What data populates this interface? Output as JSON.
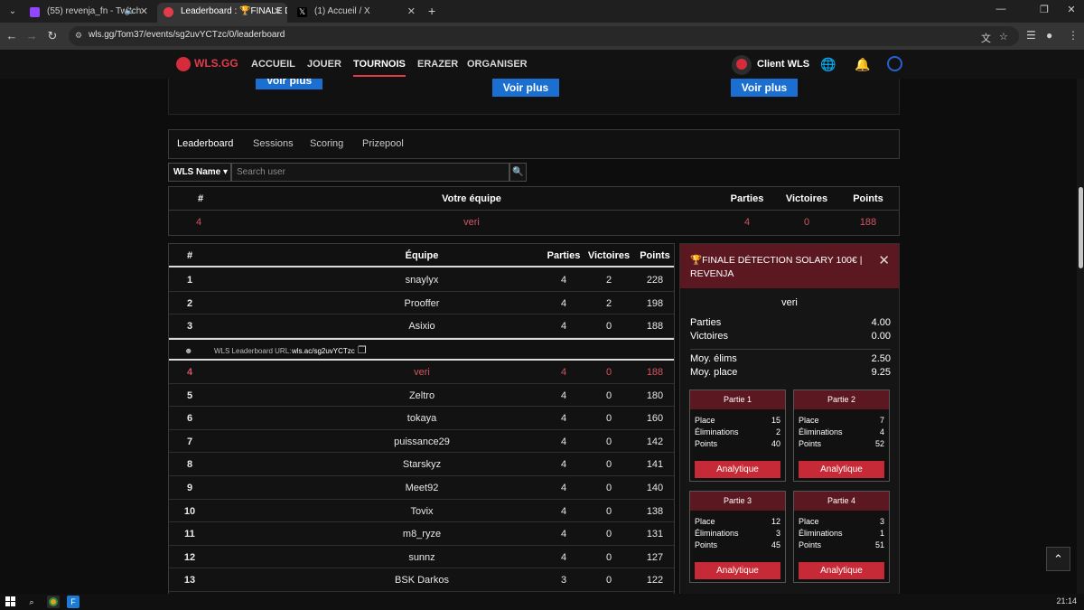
{
  "browser": {
    "tabs": [
      {
        "title": "(55) revenja_fn - Twitch",
        "favicon_color": "#9146ff"
      },
      {
        "title": "Leaderboard : 🏆FINALE DÉTECTI",
        "favicon_color": "#e23b4a"
      },
      {
        "title": "(1) Accueil / X",
        "favicon_color": "#000000"
      }
    ],
    "new_tab_label": "+",
    "url": "wls.gg/Tom37/events/sg2uvYCTzc/0/leaderboard"
  },
  "site": {
    "logo": "WLS.GG",
    "nav": [
      "ACCUEIL",
      "JOUER",
      "TOURNOIS",
      "ERAZER",
      "ORGANISER"
    ],
    "active_nav": "TOURNOIS",
    "client_label": "Client WLS"
  },
  "top_panel": {
    "buttons": [
      "Voir plus",
      "Voir plus",
      "Voir plus"
    ]
  },
  "subtabs": [
    "Leaderboard",
    "Sessions",
    "Scoring",
    "Prizepool"
  ],
  "search": {
    "filter_label": "WLS Name",
    "placeholder": "Search user"
  },
  "your_team": {
    "headers": {
      "rank": "#",
      "team": "Votre équipe",
      "games": "Parties",
      "wins": "Victoires",
      "points": "Points"
    },
    "row": {
      "rank": "4",
      "team": "veri",
      "games": "4",
      "wins": "0",
      "points": "188"
    }
  },
  "leaderboard": {
    "headers": {
      "rank": "#",
      "team": "Équipe",
      "games": "Parties",
      "wins": "Victoires",
      "points": "Points"
    },
    "url_label": "WLS Leaderboard URL:",
    "url_value": "wls.ac/sg2uvYCTzc",
    "rows_top": [
      {
        "rank": "1",
        "team": "snaylyx",
        "games": "4",
        "wins": "2",
        "points": "228"
      },
      {
        "rank": "2",
        "team": "Prooffer",
        "games": "4",
        "wins": "2",
        "points": "198"
      },
      {
        "rank": "3",
        "team": "Asixio",
        "games": "4",
        "wins": "0",
        "points": "188"
      }
    ],
    "rows": [
      {
        "rank": "4",
        "team": "veri",
        "games": "4",
        "wins": "0",
        "points": "188"
      },
      {
        "rank": "5",
        "team": "Zeltro",
        "games": "4",
        "wins": "0",
        "points": "180"
      },
      {
        "rank": "6",
        "team": "tokaya",
        "games": "4",
        "wins": "0",
        "points": "160"
      },
      {
        "rank": "7",
        "team": "puissance29",
        "games": "4",
        "wins": "0",
        "points": "142"
      },
      {
        "rank": "8",
        "team": "Starskyz",
        "games": "4",
        "wins": "0",
        "points": "141"
      },
      {
        "rank": "9",
        "team": "Meet92",
        "games": "4",
        "wins": "0",
        "points": "140"
      },
      {
        "rank": "10",
        "team": "Tovix",
        "games": "4",
        "wins": "0",
        "points": "138"
      },
      {
        "rank": "11",
        "team": "m8_ryze",
        "games": "4",
        "wins": "0",
        "points": "131"
      },
      {
        "rank": "12",
        "team": "sunnz",
        "games": "4",
        "wins": "0",
        "points": "127"
      },
      {
        "rank": "13",
        "team": "BSK Darkos",
        "games": "3",
        "wins": "0",
        "points": "122"
      }
    ]
  },
  "side_panel": {
    "title": "🏆FINALE DÉTECTION SOLARY 100€ | REVENJA",
    "team": "veri",
    "stats": [
      {
        "label": "Parties",
        "value": "4.00"
      },
      {
        "label": "Victoires",
        "value": "0.00"
      },
      {
        "label": "Moy. élims",
        "value": "2.50"
      },
      {
        "label": "Moy. place",
        "value": "9.25"
      }
    ],
    "games": [
      {
        "title": "Partie 1",
        "place": "15",
        "elims": "2",
        "points": "40"
      },
      {
        "title": "Partie 2",
        "place": "7",
        "elims": "4",
        "points": "52"
      },
      {
        "title": "Partie 3",
        "place": "12",
        "elims": "3",
        "points": "45"
      },
      {
        "title": "Partie 4",
        "place": "3",
        "elims": "1",
        "points": "51"
      }
    ],
    "labels": {
      "place": "Place",
      "elims": "Éliminations",
      "points": "Points",
      "button": "Analytique"
    }
  },
  "taskbar": {
    "clock": "21:14"
  }
}
